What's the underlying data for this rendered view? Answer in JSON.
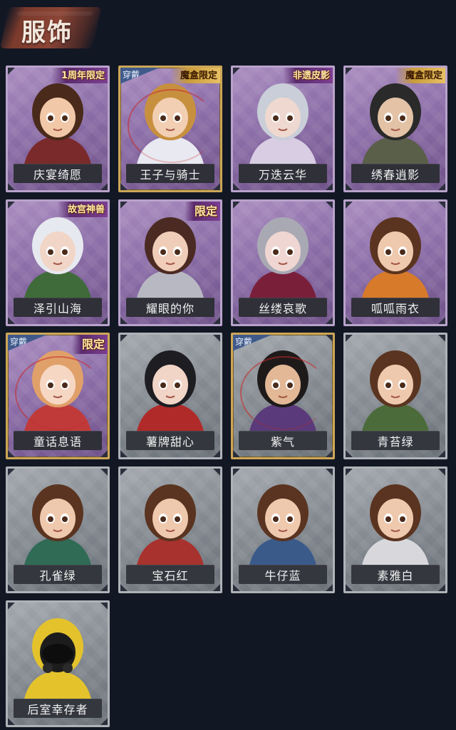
{
  "header": {
    "title": "服饰"
  },
  "costumes": [
    {
      "name": "庆宴绮愿",
      "tag": "1周年限定",
      "equipped": false,
      "rarity": "purple",
      "hair": "#4a2a1a",
      "skin": "#f1c8a8",
      "outfit": "#7a2a2a"
    },
    {
      "name": "王子与骑士",
      "tag": "魔盒限定",
      "equipped": true,
      "rarity": "purple",
      "hair": "#c7903f",
      "skin": "#f2cfb2",
      "outfit": "#e9e9f1"
    },
    {
      "name": "万迭云华",
      "tag": "非遗皮影",
      "equipped": false,
      "rarity": "purple",
      "hair": "#c9ced8",
      "skin": "#efd8cf",
      "outfit": "#d8cde3"
    },
    {
      "name": "绣春逍影",
      "tag": "魔盒限定",
      "equipped": false,
      "rarity": "purple",
      "hair": "#2a2a2a",
      "skin": "#e3c2a6",
      "outfit": "#5a5f4a"
    },
    {
      "name": "泽引山海",
      "tag": "故宫神兽",
      "equipped": false,
      "rarity": "purple",
      "hair": "#e6e9ef",
      "skin": "#f1d6c8",
      "outfit": "#3f6b3a"
    },
    {
      "name": "耀眼的你",
      "tag": "限定",
      "equipped": false,
      "rarity": "purple",
      "hair": "#4a2a22",
      "skin": "#f0cdb8",
      "outfit": "#b8b8c2"
    },
    {
      "name": "丝缕哀歌",
      "tag": "",
      "equipped": false,
      "rarity": "purple",
      "hair": "#a9a9b4",
      "skin": "#efd6d2",
      "outfit": "#7a1f3a"
    },
    {
      "name": "呱呱雨衣",
      "tag": "",
      "equipped": false,
      "rarity": "purple",
      "hair": "#5a3420",
      "skin": "#efc9ad",
      "outfit": "#d77a2a"
    },
    {
      "name": "童话息语",
      "tag": "限定",
      "equipped": true,
      "rarity": "purple",
      "hair": "#e0a06a",
      "skin": "#f6d7c3",
      "outfit": "#c03a3a"
    },
    {
      "name": "薯牌甜心",
      "tag": "",
      "equipped": false,
      "rarity": "gray",
      "hair": "#1d1d22",
      "skin": "#f1d5c7",
      "outfit": "#b02a2a"
    },
    {
      "name": "紫气",
      "tag": "",
      "equipped": true,
      "rarity": "gray",
      "hair": "#1f1a1a",
      "skin": "#e2b896",
      "outfit": "#5a3a7a"
    },
    {
      "name": "青苔绿",
      "tag": "",
      "equipped": false,
      "rarity": "gray",
      "hair": "#5a3420",
      "skin": "#efc9ad",
      "outfit": "#4c6b3a"
    },
    {
      "name": "孔雀绿",
      "tag": "",
      "equipped": false,
      "rarity": "gray",
      "hair": "#5a3420",
      "skin": "#efc9ad",
      "outfit": "#2f6b55"
    },
    {
      "name": "宝石红",
      "tag": "",
      "equipped": false,
      "rarity": "gray",
      "hair": "#5a3420",
      "skin": "#efc9ad",
      "outfit": "#a8322d"
    },
    {
      "name": "牛仔蓝",
      "tag": "",
      "equipped": false,
      "rarity": "gray",
      "hair": "#5a3420",
      "skin": "#efc9ad",
      "outfit": "#3a5a8a"
    },
    {
      "name": "素雅白",
      "tag": "",
      "equipped": false,
      "rarity": "gray",
      "hair": "#5a3420",
      "skin": "#efc9ad",
      "outfit": "#d8d8dc"
    },
    {
      "name": "后室幸存者",
      "tag": "",
      "equipped": false,
      "rarity": "gray",
      "hair": "#e4c22c",
      "skin": "#1c1c1c",
      "outfit": "#e4c22c"
    }
  ],
  "labels": {
    "wear": "穿戴"
  }
}
